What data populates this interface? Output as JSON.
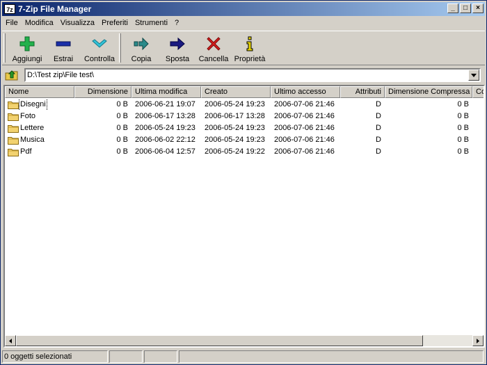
{
  "window": {
    "title": "7-Zip File Manager",
    "icon_text": "7z",
    "minimize": "_",
    "maximize": "□",
    "close": "×"
  },
  "menu": [
    "File",
    "Modifica",
    "Visualizza",
    "Preferiti",
    "Strumenti",
    "?"
  ],
  "toolbar": {
    "add": "Aggiungi",
    "extract": "Estrai",
    "test": "Controlla",
    "copy": "Copia",
    "move": "Sposta",
    "delete": "Cancella",
    "info": "Proprietà"
  },
  "colors": {
    "add": "#22b14c",
    "extract": "#1a2ea8",
    "test": "#33c3d9",
    "copy": "#2a8a8a",
    "move": "#1a1a80",
    "delete": "#d81e1e",
    "info": "#e6d300"
  },
  "address": {
    "path": "D:\\Test zip\\File test\\"
  },
  "columns": [
    "Nome",
    "Dimensione",
    "Ultima modifica",
    "Creato",
    "Ultimo accesso",
    "Attributi",
    "Dimensione Compressa",
    "Co"
  ],
  "rows": [
    {
      "name": "Disegni",
      "size": "0 B",
      "modified": "2006-06-21 19:07",
      "created": "2006-05-24 19:23",
      "accessed": "2006-07-06 21:46",
      "attr": "D",
      "packed": "0 B"
    },
    {
      "name": "Foto",
      "size": "0 B",
      "modified": "2006-06-17 13:28",
      "created": "2006-06-17 13:28",
      "accessed": "2006-07-06 21:46",
      "attr": "D",
      "packed": "0 B"
    },
    {
      "name": "Lettere",
      "size": "0 B",
      "modified": "2006-05-24 19:23",
      "created": "2006-05-24 19:23",
      "accessed": "2006-07-06 21:46",
      "attr": "D",
      "packed": "0 B"
    },
    {
      "name": "Musica",
      "size": "0 B",
      "modified": "2006-06-02 22:12",
      "created": "2006-05-24 19:23",
      "accessed": "2006-07-06 21:46",
      "attr": "D",
      "packed": "0 B"
    },
    {
      "name": "Pdf",
      "size": "0 B",
      "modified": "2006-06-04 12:57",
      "created": "2006-05-24 19:22",
      "accessed": "2006-07-06 21:46",
      "attr": "D",
      "packed": "0 B"
    }
  ],
  "status": {
    "selected": "0 oggetti selezionati",
    "p2": "",
    "p3": "",
    "p4": ""
  }
}
